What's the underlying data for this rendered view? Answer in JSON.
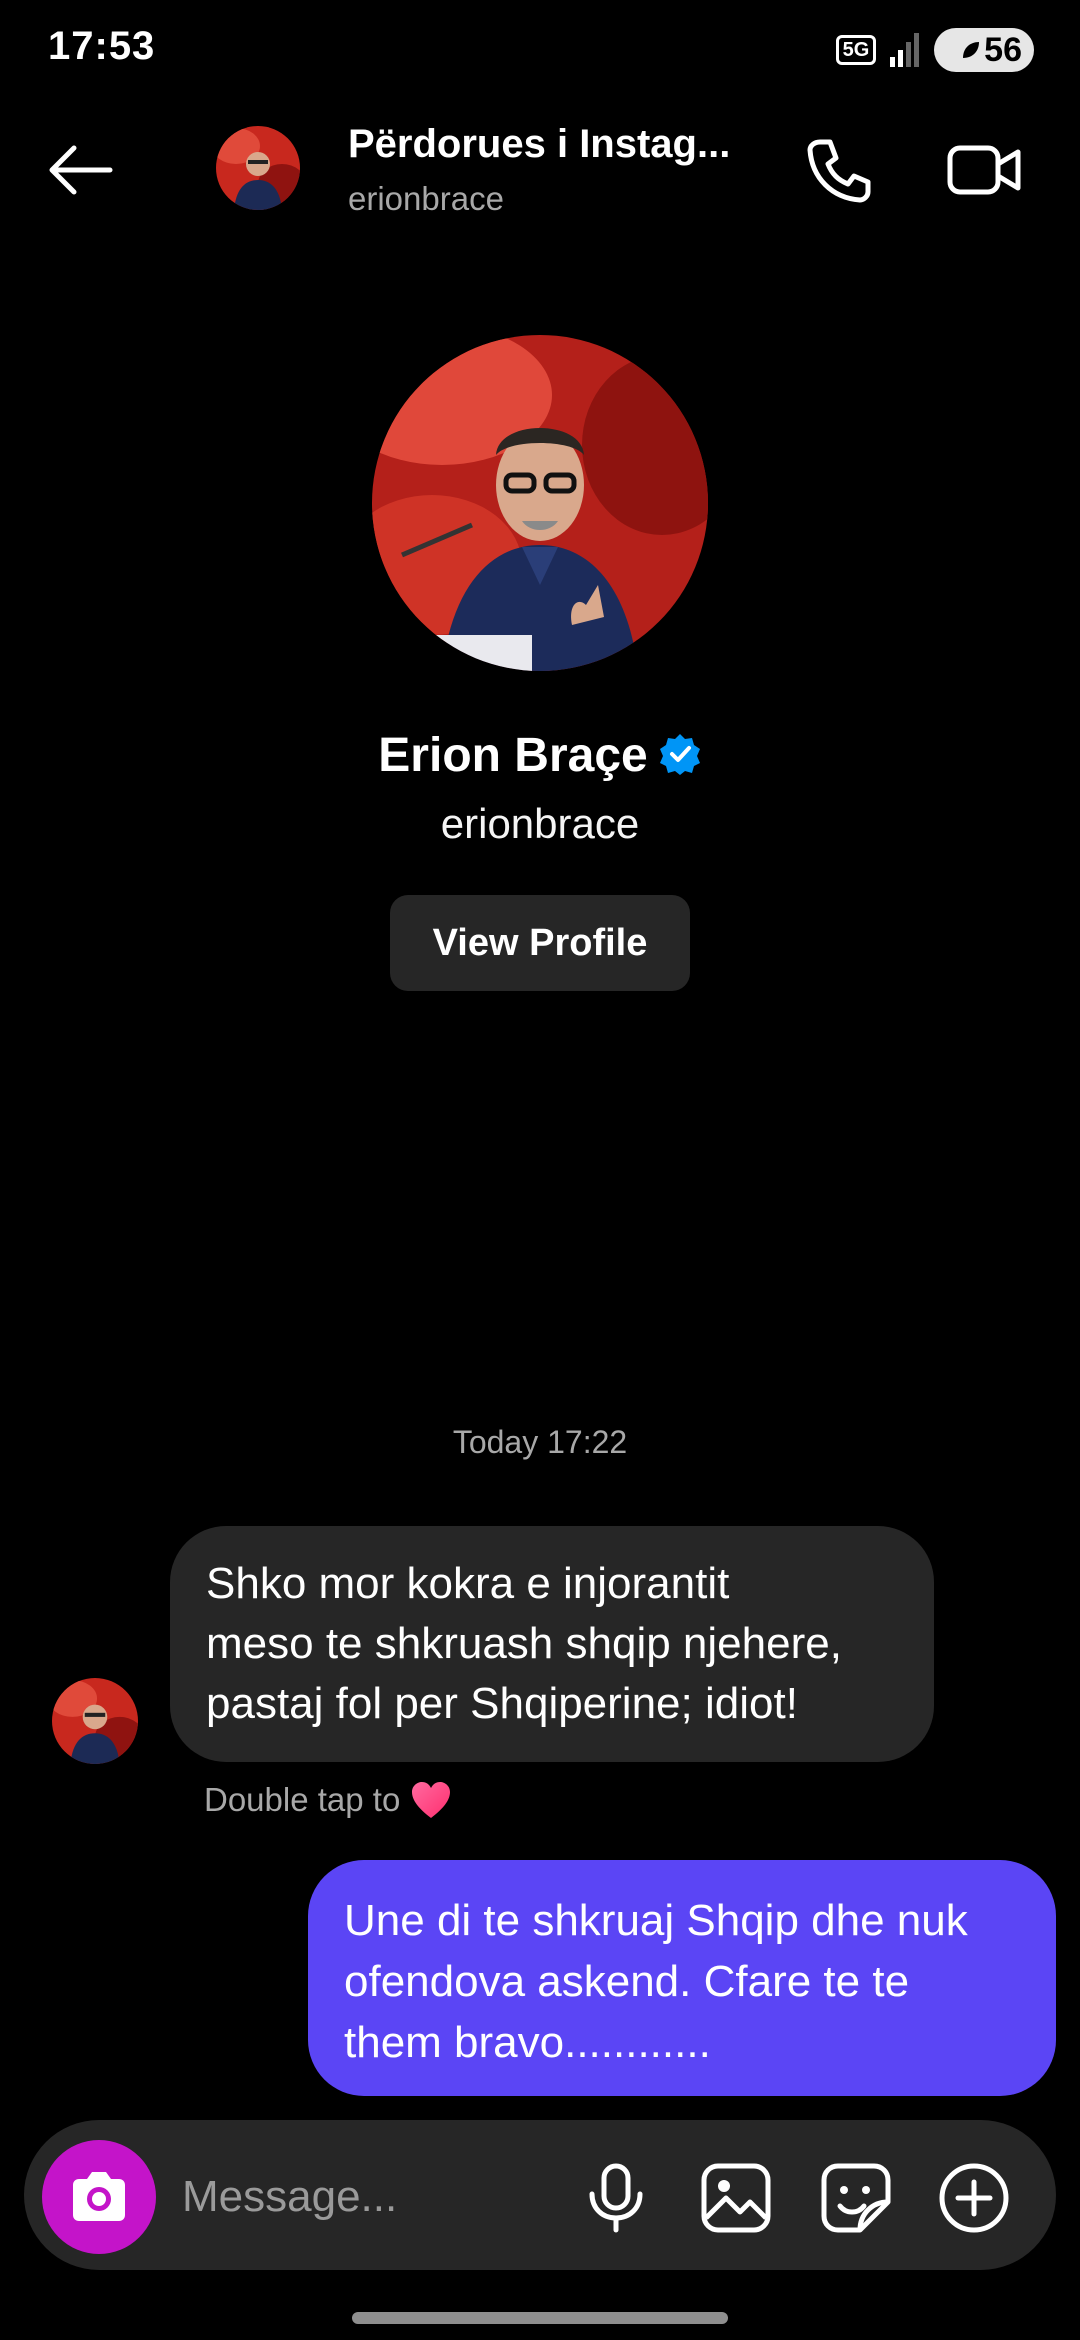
{
  "status_bar": {
    "time": "17:53",
    "network": "5G",
    "battery": "56",
    "icons": [
      "5g-icon",
      "signal-icon",
      "battery-icon"
    ]
  },
  "header": {
    "display_name": "Përdorues i Instag...",
    "username": "erionbrace",
    "icons": [
      "back-arrow-icon",
      "phone-icon",
      "video-camera-icon"
    ]
  },
  "profile": {
    "name": "Erion Braçe",
    "username": "erionbrace",
    "verified_color": "#0095f6",
    "view_profile_label": "View Profile"
  },
  "conversation": {
    "timestamp": "Today 17:22",
    "messages": [
      {
        "direction": "incoming",
        "lines": [
          "Shko mor kokra e injorantit",
          "meso te shkruash shqip njehere,",
          "pastaj fol per Shqiperine; idiot!"
        ]
      },
      {
        "direction": "outgoing",
        "lines": [
          "Une di te shkruaj Shqip dhe nuk",
          "ofendova askend. Cfare te te",
          "them bravo............"
        ]
      }
    ],
    "double_tap_hint": "Double tap to",
    "hint_icon": "heart-icon"
  },
  "composer": {
    "placeholder": "Message...",
    "accent_color": "#c414c9",
    "icons": [
      "camera-icon",
      "microphone-icon",
      "gallery-icon",
      "sticker-icon",
      "plus-icon"
    ]
  },
  "colors": {
    "background": "#000000",
    "incoming_bubble": "#262626",
    "outgoing_bubble": "#5b45f5"
  }
}
